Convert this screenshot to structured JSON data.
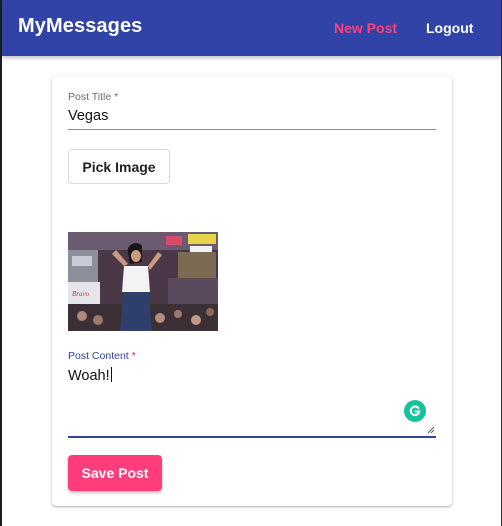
{
  "app": {
    "title": "MyMessages"
  },
  "nav": {
    "new_post": "New Post",
    "logout": "Logout"
  },
  "form": {
    "title_label": "Post Title *",
    "title_value": "Vegas",
    "pick_image_label": "Pick Image",
    "content_label": "Post Content",
    "content_required": "*",
    "content_value": "Woah!",
    "save_label": "Save Post"
  },
  "colors": {
    "primary": "#3143a6",
    "accent": "#ff3d7b",
    "grammarly": "#15c39a"
  },
  "icons": {
    "grammarly": "grammarly-icon",
    "resize": "resize-handle-icon"
  }
}
